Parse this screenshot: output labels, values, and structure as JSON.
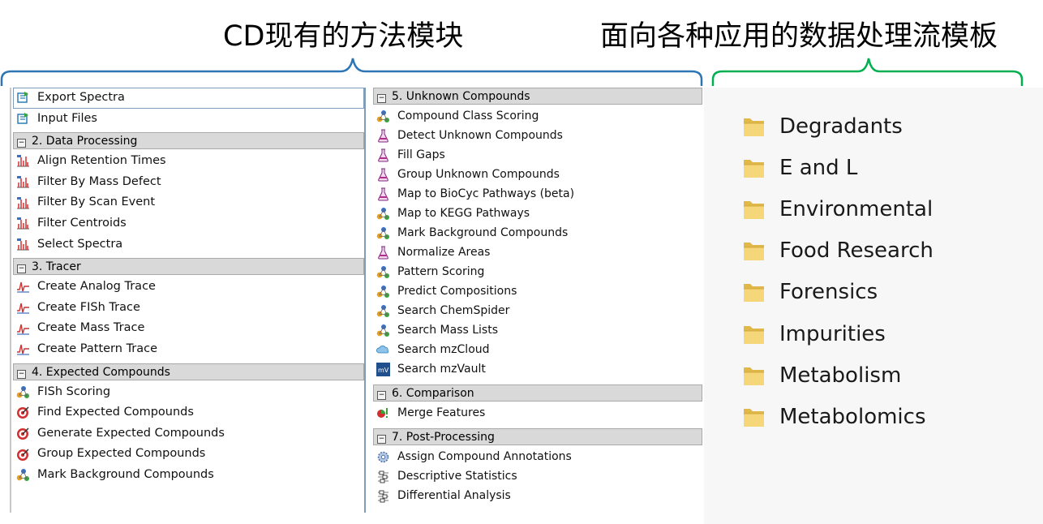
{
  "titles": {
    "left": "CD现有的方法模块",
    "right": "面向各种应用的数据处理流模板"
  },
  "colors": {
    "left_brace": "#2e75b6",
    "right_brace": "#00b050"
  },
  "left_panel": {
    "top_items": [
      {
        "label": "Export Spectra",
        "icon": "export-icon",
        "selected": true
      },
      {
        "label": "Input Files",
        "icon": "export-icon",
        "selected": false
      }
    ],
    "groups": [
      {
        "header": "2. Data Processing",
        "items": [
          {
            "label": "Align Retention Times",
            "icon": "spectrum-icon"
          },
          {
            "label": "Filter By Mass Defect",
            "icon": "spectrum-icon"
          },
          {
            "label": "Filter By Scan Event",
            "icon": "spectrum-icon"
          },
          {
            "label": "Filter Centroids",
            "icon": "spectrum-icon"
          },
          {
            "label": "Select Spectra",
            "icon": "spectrum-icon"
          }
        ]
      },
      {
        "header": "3. Tracer",
        "items": [
          {
            "label": "Create Analog Trace",
            "icon": "trace-icon"
          },
          {
            "label": "Create FISh Trace",
            "icon": "trace-icon"
          },
          {
            "label": "Create Mass Trace",
            "icon": "trace-icon"
          },
          {
            "label": "Create Pattern Trace",
            "icon": "trace-icon"
          }
        ]
      },
      {
        "header": "4. Expected Compounds",
        "items": [
          {
            "label": "FISh Scoring",
            "icon": "molecule-icon"
          },
          {
            "label": "Find Expected Compounds",
            "icon": "target-icon"
          },
          {
            "label": "Generate Expected Compounds",
            "icon": "target-icon"
          },
          {
            "label": "Group Expected Compounds",
            "icon": "target-icon"
          },
          {
            "label": "Mark Background Compounds",
            "icon": "molecule-icon"
          }
        ]
      }
    ]
  },
  "mid_panel": {
    "groups": [
      {
        "header": "5. Unknown Compounds",
        "items": [
          {
            "label": "Compound Class Scoring",
            "icon": "molecule-icon"
          },
          {
            "label": "Detect Unknown Compounds",
            "icon": "flask-icon"
          },
          {
            "label": "Fill Gaps",
            "icon": "flask-icon"
          },
          {
            "label": "Group Unknown Compounds",
            "icon": "flask-icon"
          },
          {
            "label": "Map to BioCyc Pathways (beta)",
            "icon": "flask-icon"
          },
          {
            "label": "Map to KEGG Pathways",
            "icon": "molecule-icon"
          },
          {
            "label": "Mark Background Compounds",
            "icon": "molecule-icon"
          },
          {
            "label": "Normalize Areas",
            "icon": "flask-icon"
          },
          {
            "label": "Pattern Scoring",
            "icon": "molecule-icon"
          },
          {
            "label": "Predict Compositions",
            "icon": "molecule-icon"
          },
          {
            "label": "Search ChemSpider",
            "icon": "molecule-icon"
          },
          {
            "label": "Search Mass Lists",
            "icon": "molecule-icon"
          },
          {
            "label": "Search mzCloud",
            "icon": "cloud-icon"
          },
          {
            "label": "Search mzVault",
            "icon": "vault-icon"
          }
        ]
      },
      {
        "header": "6. Comparison",
        "items": [
          {
            "label": "Merge Features",
            "icon": "merge-icon"
          }
        ]
      },
      {
        "header": "7. Post-Processing",
        "items": [
          {
            "label": "Assign Compound Annotations",
            "icon": "gear-icon"
          },
          {
            "label": "Descriptive Statistics",
            "icon": "stats-icon"
          },
          {
            "label": "Differential Analysis",
            "icon": "stats-icon"
          }
        ]
      }
    ]
  },
  "templates": {
    "folders": [
      {
        "label": "Degradants"
      },
      {
        "label": "E and L"
      },
      {
        "label": "Environmental"
      },
      {
        "label": "Food Research"
      },
      {
        "label": "Forensics"
      },
      {
        "label": "Impurities"
      },
      {
        "label": "Metabolism"
      },
      {
        "label": "Metabolomics"
      }
    ]
  }
}
